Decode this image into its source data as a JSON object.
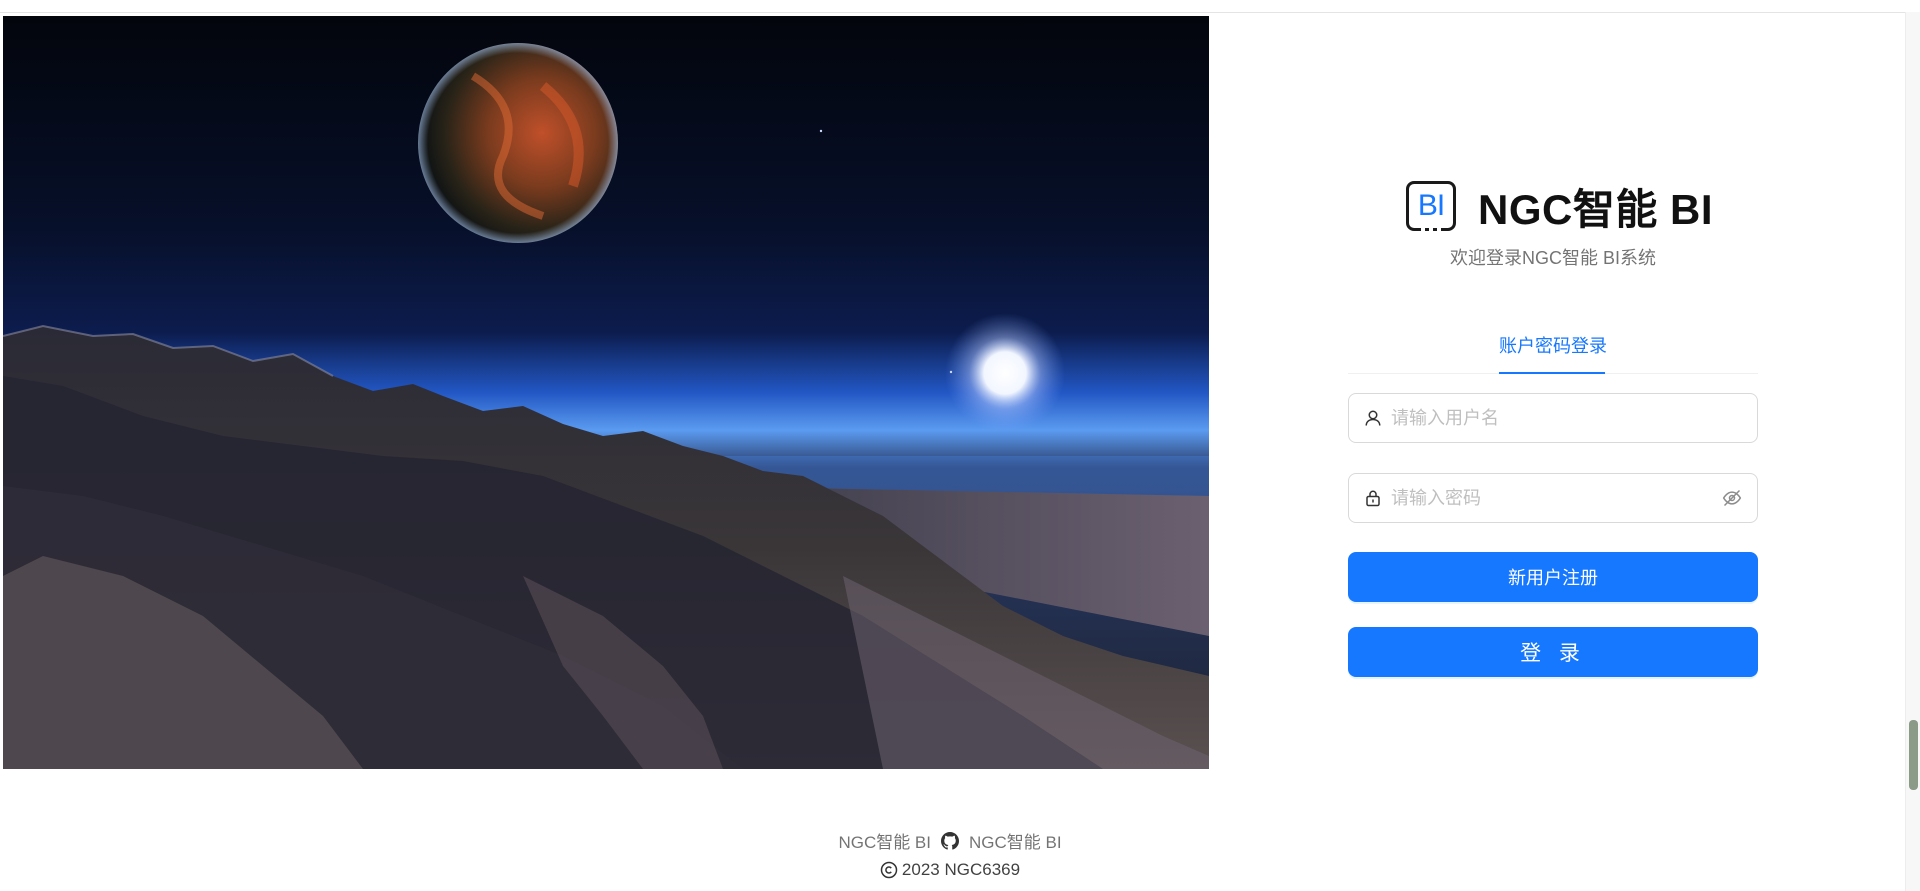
{
  "brand": {
    "logo_text": "BI",
    "title": "NGC智能 BI",
    "subtitle": "欢迎登录NGC智能 BI系统"
  },
  "tabs": [
    {
      "label": "账户密码登录",
      "active": true
    }
  ],
  "form": {
    "username_placeholder": "请输入用户名",
    "password_placeholder": "请输入密码",
    "register_label": "新用户注册",
    "login_label": "登 录"
  },
  "footer": {
    "link_left": "NGC智能 BI",
    "link_right": "NGC智能 BI",
    "copyright": "2023 NGC6369"
  },
  "colors": {
    "primary": "#1677ff",
    "border": "#d9d9d9",
    "placeholder": "#bfbfbf"
  },
  "icons": {
    "username": "user-icon",
    "password": "lock-icon",
    "visibility": "eye-invisible-icon",
    "footer_separator": "github-icon",
    "copyright": "copyright-icon"
  }
}
